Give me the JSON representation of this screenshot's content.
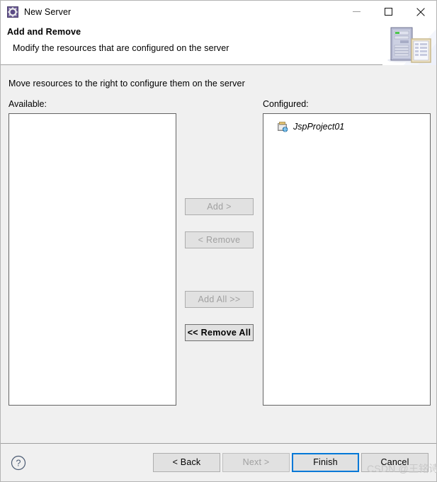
{
  "window": {
    "title": "New Server",
    "icon": "server-gear-icon",
    "controls": {
      "minimize": "minimize-icon",
      "maximize": "maximize-icon",
      "close": "close-icon"
    }
  },
  "header": {
    "title": "Add and Remove",
    "subtitle": "Modify the resources that are configured on the server",
    "graphic": "server-and-document-icon"
  },
  "main": {
    "instruction": "Move resources to the right to configure them on the server",
    "available": {
      "label": "Available:",
      "items": []
    },
    "configured": {
      "label": "Configured:",
      "items": [
        {
          "name": "JspProject01",
          "icon": "project-globe-icon"
        }
      ]
    },
    "transfer_buttons": [
      {
        "label": "Add >",
        "enabled": false,
        "name": "add-button"
      },
      {
        "label": "< Remove",
        "enabled": false,
        "name": "remove-button"
      },
      {
        "label": "Add All >>",
        "enabled": false,
        "name": "add-all-button"
      },
      {
        "label": "<< Remove All",
        "enabled": true,
        "name": "remove-all-button"
      }
    ]
  },
  "footer": {
    "help": "help-icon",
    "buttons": [
      {
        "label": "< Back",
        "state": "enabled"
      },
      {
        "label": "Next >",
        "state": "disabled"
      },
      {
        "label": "Finish",
        "state": "default"
      },
      {
        "label": "Cancel",
        "state": "enabled"
      }
    ]
  },
  "watermark": {
    "text": "CSDN @王铭诗"
  },
  "colors": {
    "accent": "#0078d7",
    "page_bg": "#f0f0f0",
    "titlebar_bg": "#ffffff",
    "button_bg": "#e1e1e1",
    "border": "#646464",
    "disabled_text": "#a0a0a0"
  }
}
